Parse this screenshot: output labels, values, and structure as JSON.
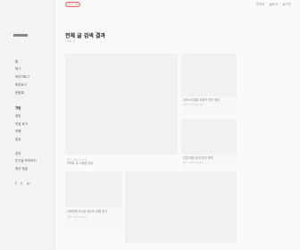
{
  "sidebar": {
    "items": [
      {
        "label": "홈",
        "bold": false
      },
      {
        "label": "태그",
        "bold": false
      },
      {
        "label": "미디어로그",
        "bold": false
      },
      {
        "label": "위치로그",
        "bold": false
      },
      {
        "label": "방명록",
        "bold": false
      },
      {
        "label": "개발",
        "bold": true
      },
      {
        "label": "취미",
        "bold": false
      },
      {
        "label": "맛집 후기",
        "bold": false
      },
      {
        "label": "여행",
        "bold": false
      },
      {
        "label": "일상",
        "bold": false
      },
      {
        "label": "공지",
        "bold": false
      },
      {
        "label": "인기글 모아보기",
        "bold": false
      },
      {
        "label": "최근 댓글",
        "bold": false
      }
    ],
    "social": [
      "f",
      "t",
      "in"
    ]
  },
  "header": {
    "write_button": "글쓰기 관리",
    "links": [
      "관리자",
      "글쓰기",
      "로그인"
    ]
  },
  "main": {
    "title": "전체 글 검색 결과",
    "count": "6개의 글",
    "cards": [
      {
        "caption": "",
        "meta": ""
      },
      {
        "caption": "자바스크립트 비동기 처리 정리",
        "meta": "개발 · 2021.03.12"
      },
      {
        "caption": "주말 캠핑 장비 추천 목록",
        "meta": "취미 · 2021.02.20"
      },
      {
        "caption": "리액트 훅 사용법 정리",
        "meta": "개발 · 2021.02.05"
      },
      {
        "caption": "오랜만에 다녀온 제주도 여행 후기",
        "meta": "여행 · 2021.01.18"
      },
      {
        "caption": "",
        "meta": ""
      }
    ]
  }
}
